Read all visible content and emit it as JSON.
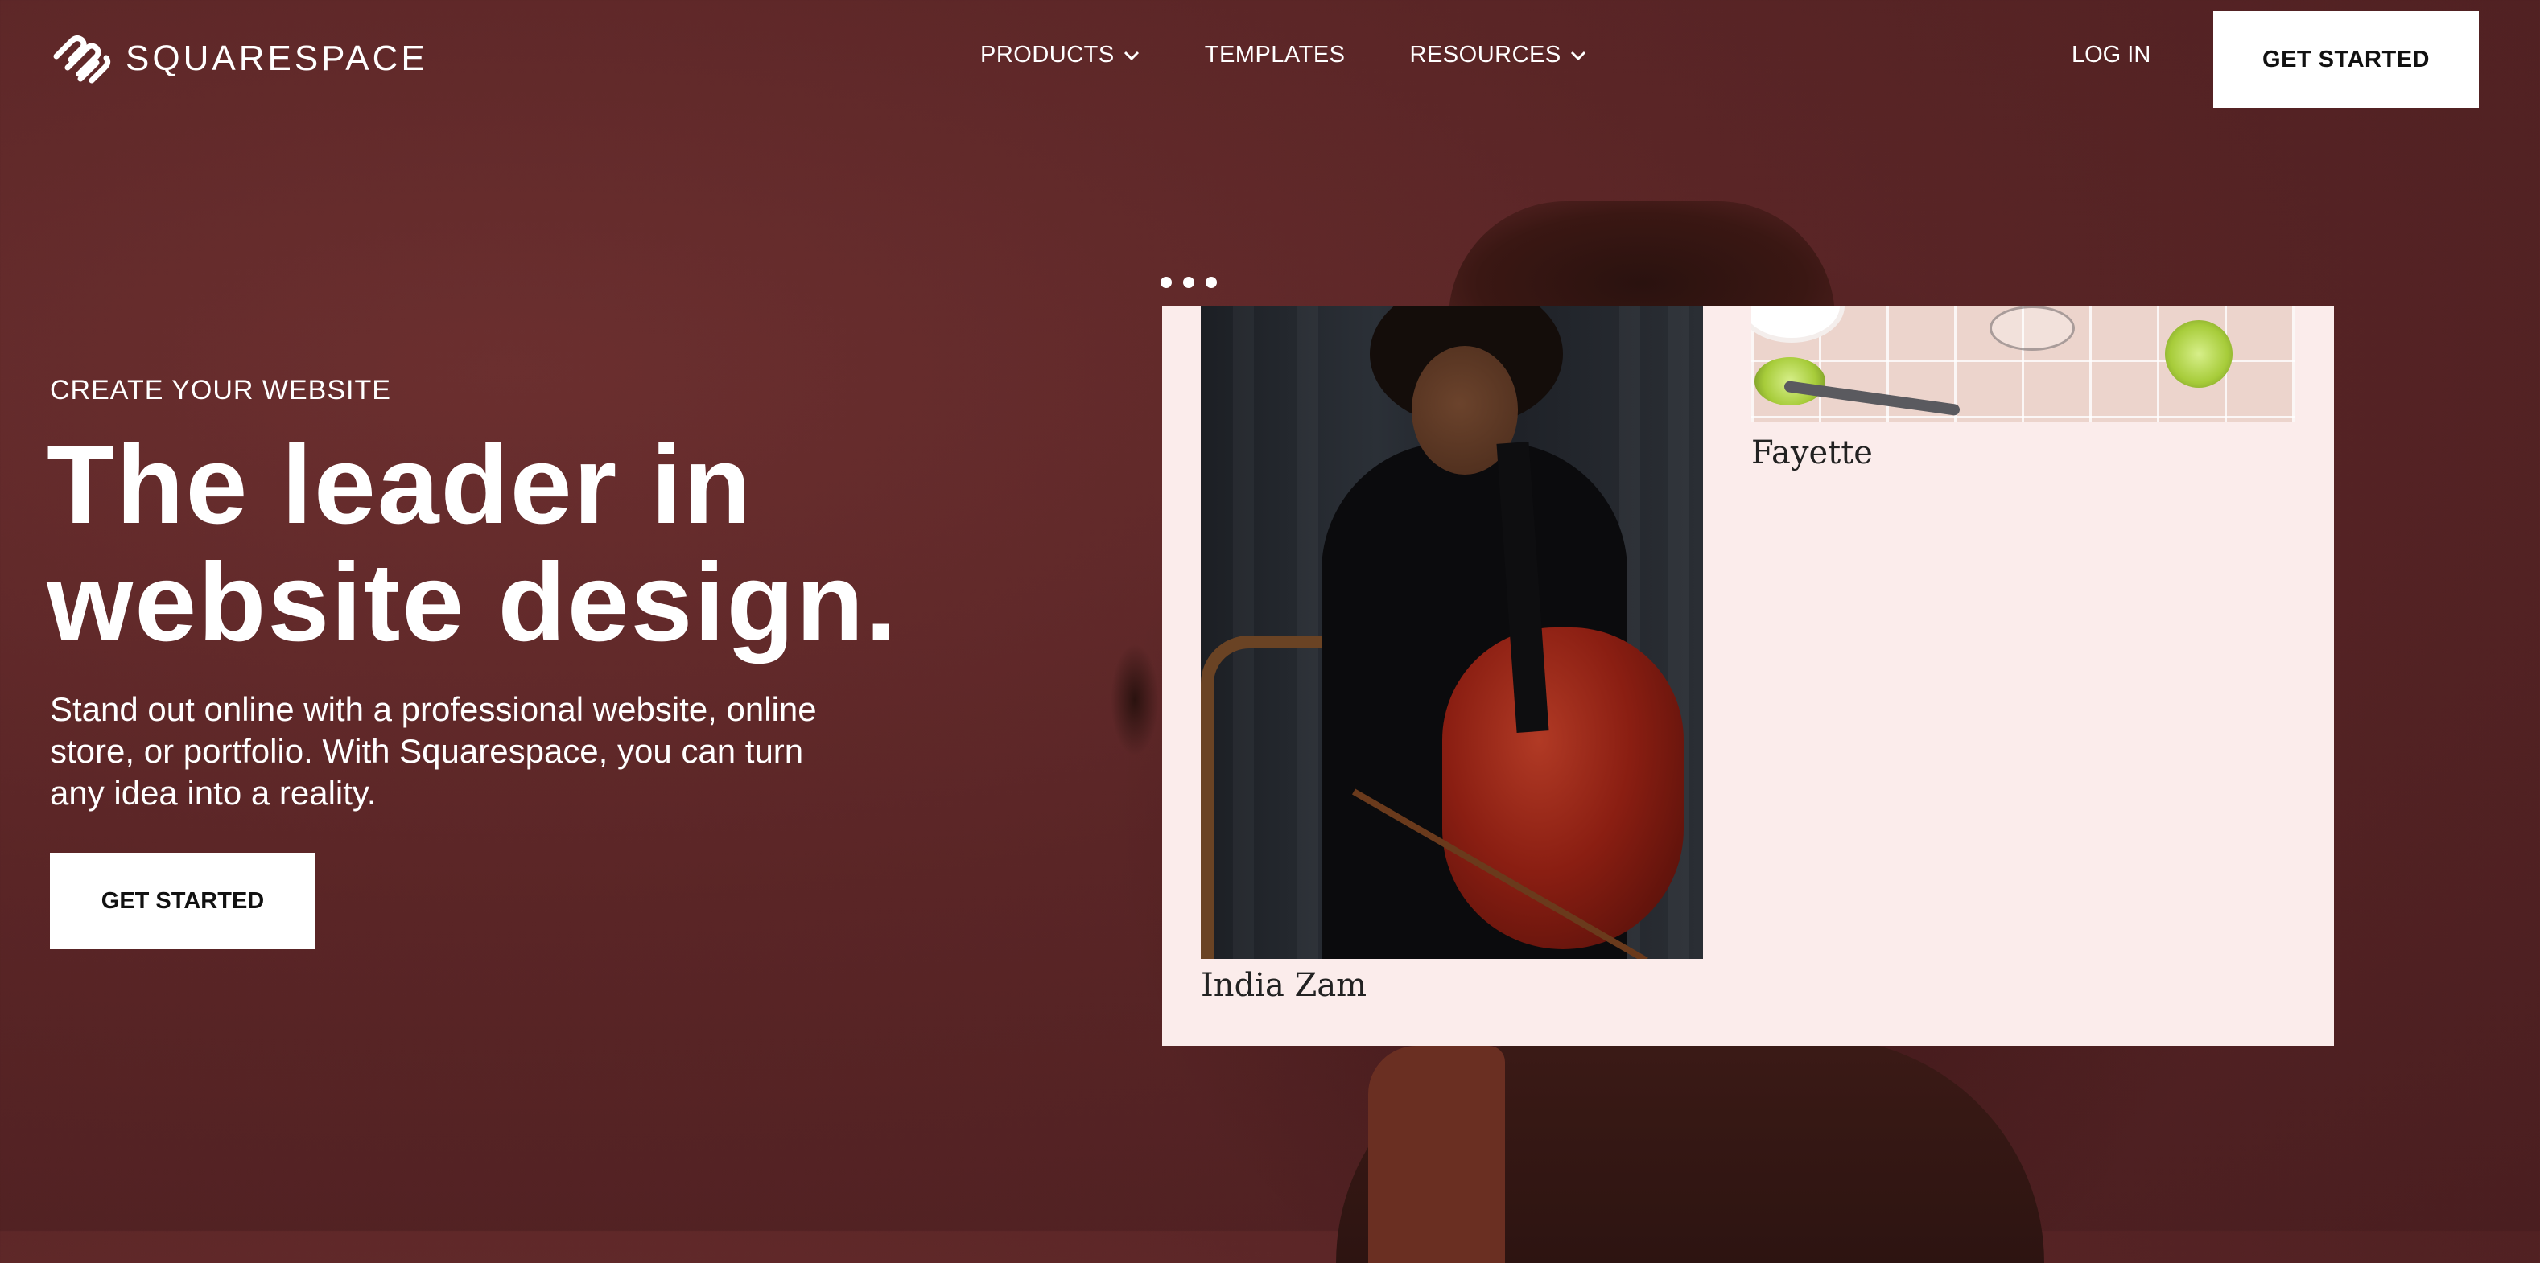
{
  "brand": {
    "name": "SQUARESPACE"
  },
  "nav": {
    "items": [
      {
        "label": "PRODUCTS",
        "has_dropdown": true
      },
      {
        "label": "TEMPLATES",
        "has_dropdown": false
      },
      {
        "label": "RESOURCES",
        "has_dropdown": true
      }
    ],
    "login_label": "LOG IN",
    "cta_label": "GET STARTED"
  },
  "hero": {
    "eyebrow": "CREATE YOUR WEBSITE",
    "headline_line1": "The leader in",
    "headline_line2": "website design.",
    "subtext": "Stand out online with a professional website, online store, or portfolio. With Squarespace, you can turn any idea into a reality.",
    "cta_label": "GET STARTED"
  },
  "mockup": {
    "cards": [
      {
        "title": "India Zam"
      },
      {
        "title": "Fayette"
      }
    ]
  },
  "colors": {
    "background": "#5a2526",
    "mockup_background": "#fbeceb",
    "button_background": "#ffffff",
    "button_text": "#111111"
  }
}
